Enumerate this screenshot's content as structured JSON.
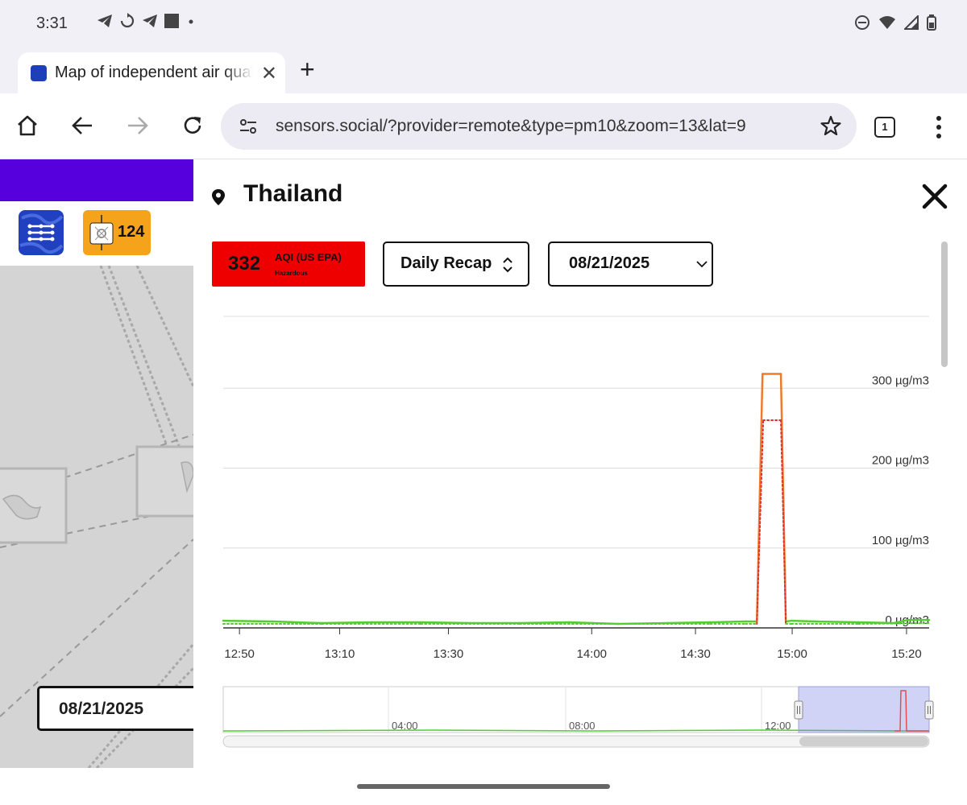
{
  "status_bar": {
    "time": "3:31"
  },
  "browser": {
    "tab_title": "Map of independent air quality",
    "url": "sensors.social/?provider=remote&type=pm10&zoom=13&lat=9",
    "tab_count": "1"
  },
  "app": {
    "sensor_count": "124",
    "date": "08/21/2025"
  },
  "panel": {
    "title": "Thailand",
    "aqi": {
      "value": "332",
      "label": "AQI (US EPA)",
      "level": "Hazardous",
      "color": "#ee0000"
    },
    "mode_select": "Daily Recap",
    "date_select": "08/21/2025"
  },
  "chart_data": {
    "type": "line",
    "x_ticks": [
      "12:50",
      "13:10",
      "13:30",
      "14:00",
      "14:30",
      "15:00",
      "15:20"
    ],
    "y_ticks": [
      "0 µg/m3",
      "100 µg/m3",
      "200 µg/m3",
      "300 µg/m3"
    ],
    "ylim": [
      0,
      390
    ],
    "grid": true,
    "series": [
      {
        "style": "solid",
        "x": [
          0,
          0.07,
          0.14,
          0.21,
          0.28,
          0.35,
          0.42,
          0.49,
          0.56,
          0.63,
          0.69,
          0.74,
          0.756,
          0.764,
          0.79,
          0.797,
          0.805,
          0.84,
          0.9,
          0.95,
          0.97,
          1.0
        ],
        "y": [
          9,
          8,
          6,
          7,
          7,
          6,
          6,
          7,
          5,
          6,
          7,
          8,
          8,
          318,
          318,
          8,
          9,
          8,
          7,
          6,
          10,
          10
        ]
      },
      {
        "style": "dotted",
        "x": [
          0,
          0.14,
          0.28,
          0.42,
          0.56,
          0.69,
          0.74,
          0.756,
          0.765,
          0.79,
          0.797,
          0.805,
          0.9,
          1.0
        ],
        "y": [
          5,
          5,
          5,
          5,
          5,
          5,
          5,
          5,
          260,
          260,
          5,
          5,
          5,
          6
        ]
      }
    ],
    "navigator": {
      "x_ticks": [
        "04:00",
        "08:00",
        "12:00"
      ]
    }
  }
}
